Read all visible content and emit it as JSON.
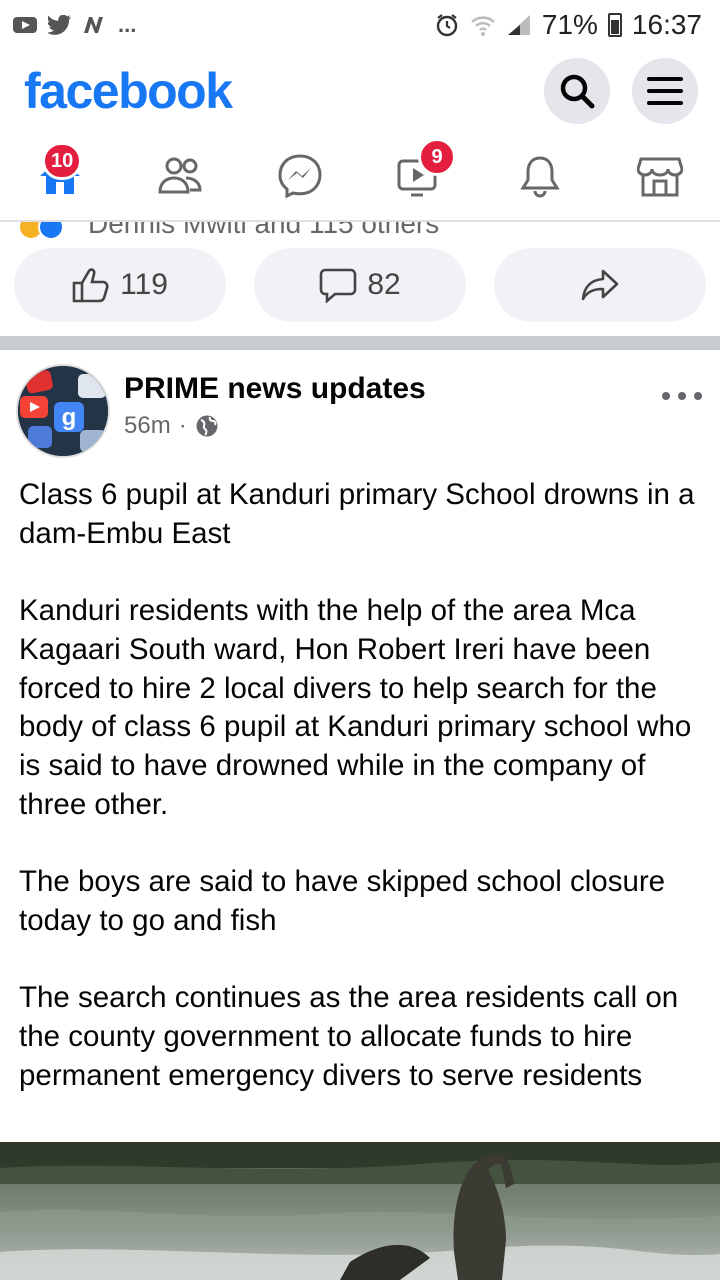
{
  "status_bar": {
    "more": "...",
    "battery": "71%",
    "time": "16:37"
  },
  "header": {
    "logo": "facebook"
  },
  "nav": {
    "home_badge": "10",
    "watch_badge": "9"
  },
  "prev_post": {
    "reactions_text": "Dennis Mwiti and 115 others",
    "like_count": "119",
    "comment_count": "82"
  },
  "post": {
    "author": "PRIME news updates",
    "time": "56m",
    "separator": "·",
    "body": "Class 6 pupil at Kanduri primary School drowns in a dam-Embu East\n\nKanduri residents with the help of the area Mca Kagaari South ward, Hon Robert Ireri have been forced to hire 2 local divers to help search for the body of class 6 pupil at Kanduri primary school who is said to have drowned while in the company of three other.\n\nThe boys are said to have skipped school closure today to go and fish\n\nThe search continues as the area residents call on the county government to allocate funds to hire permanent emergency divers to serve residents"
  },
  "colors": {
    "brand": "#1877f2",
    "badge": "#e41e3f",
    "button_bg": "#f0f2f5"
  }
}
